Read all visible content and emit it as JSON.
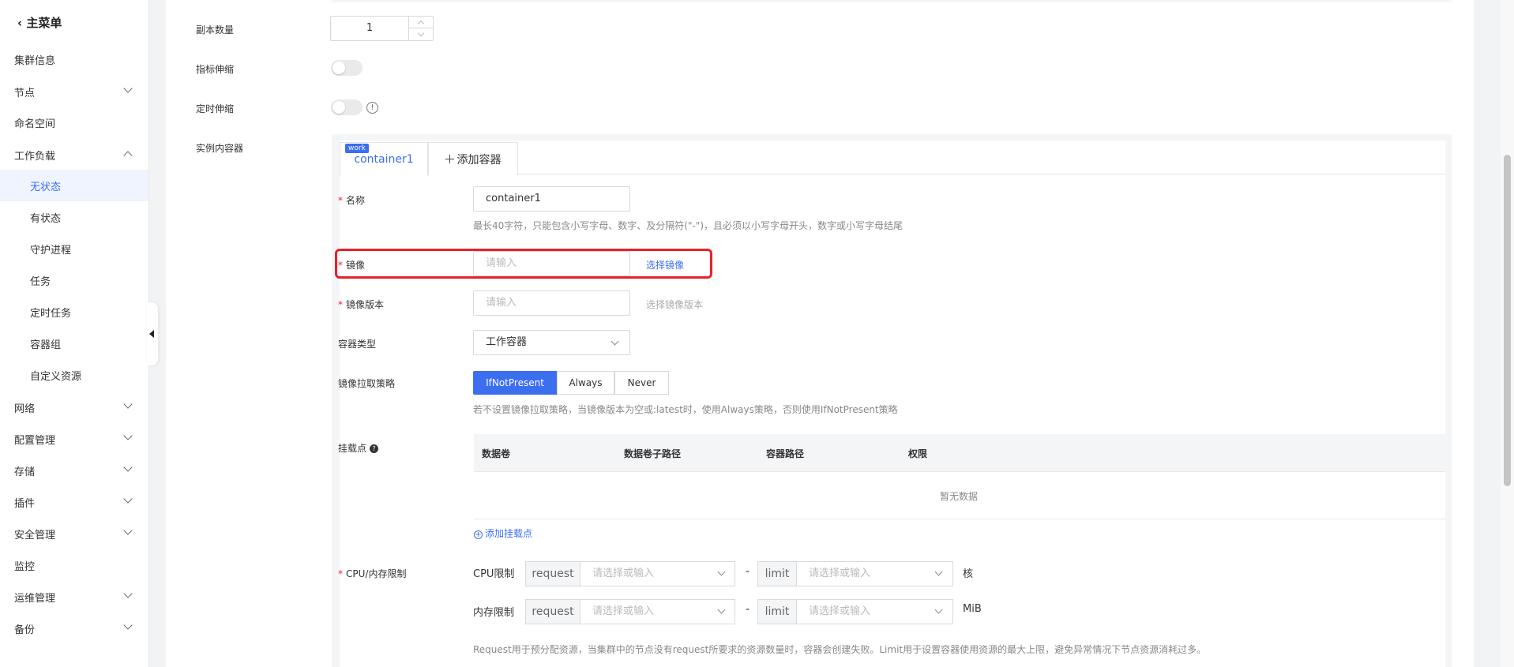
{
  "sidebar": {
    "back_label": "主菜单",
    "items": [
      {
        "label": "集群信息"
      },
      {
        "label": "节点"
      },
      {
        "label": "命名空间"
      },
      {
        "label": "工作负载"
      },
      {
        "label": "无状态"
      },
      {
        "label": "有状态"
      },
      {
        "label": "守护进程"
      },
      {
        "label": "任务"
      },
      {
        "label": "定时任务"
      },
      {
        "label": "容器组"
      },
      {
        "label": "自定义资源"
      },
      {
        "label": "网络"
      },
      {
        "label": "配置管理"
      },
      {
        "label": "存储"
      },
      {
        "label": "插件"
      },
      {
        "label": "安全管理"
      },
      {
        "label": "监控"
      },
      {
        "label": "运维管理"
      },
      {
        "label": "备份"
      }
    ],
    "active_item": "无状态"
  },
  "form": {
    "replicas_label": "副本数量",
    "replicas_value": "1",
    "metric_scaling_label": "指标伸缩",
    "scheduled_scaling_label": "定时伸缩",
    "info_icon": "info-icon",
    "containers_label": "实例内容器"
  },
  "container": {
    "tab_badge": "work",
    "tab_label": "container1",
    "add_tab_label": "添加容器",
    "name_label": "名称",
    "name_value": "container1",
    "name_hint": "最长40字符，只能包含小写字母、数字、及分隔符(\"-\")，且必须以小写字母开头，数字或小写字母结尾",
    "image_label": "镜像",
    "image_placeholder": "请输入",
    "image_select_link": "选择镜像",
    "image_version_label": "镜像版本",
    "image_version_placeholder": "请输入",
    "image_version_link": "选择镜像版本",
    "container_type_label": "容器类型",
    "container_type_value": "工作容器",
    "pull_policy_label": "镜像拉取策略",
    "pull_policy_options": [
      "IfNotPresent",
      "Always",
      "Never"
    ],
    "pull_policy_selected": "IfNotPresent",
    "pull_policy_hint": "若不设置镜像拉取策略，当镜像版本为空或:latest时，使用Always策略，否则使用IfNotPresent策略",
    "mount_label": "挂载点",
    "mount_columns": [
      "数据卷",
      "数据卷子路径",
      "容器路径",
      "权限"
    ],
    "mount_empty": "暂无数据",
    "add_mount_label": "添加挂载点",
    "limits_label": "CPU/内存限制",
    "cpu_label": "CPU限制",
    "memory_label": "内存限制",
    "request_addon": "request",
    "limit_addon": "limit",
    "select_placeholder": "请选择或输入",
    "dash": "-",
    "cpu_unit": "核",
    "memory_unit": "MiB",
    "limits_hint": "Request用于预分配资源，当集群中的节点没有request所要求的资源数量时，容器会创建失败。Limit用于设置容器使用资源的最大上限，避免异常情况下节点资源消耗过多。"
  },
  "colors": {
    "accent": "#3c6ef0",
    "highlight": "#e8202a",
    "required": "#f5222d"
  }
}
